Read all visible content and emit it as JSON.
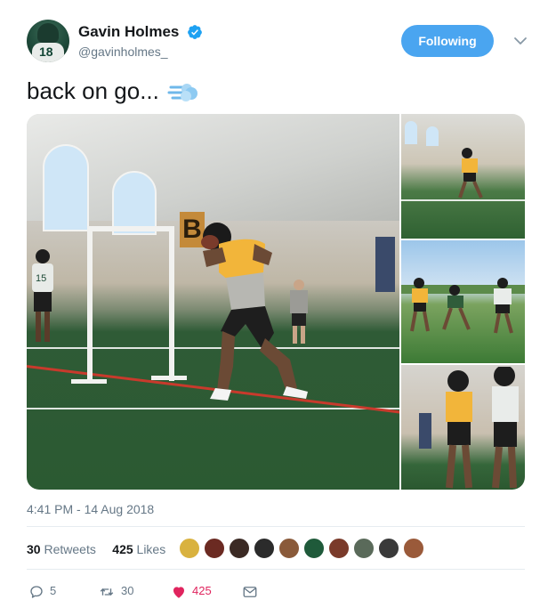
{
  "user": {
    "display_name": "Gavin Holmes",
    "handle": "@gavinholmes_",
    "avatar_jersey_number": "18"
  },
  "follow_button": {
    "label": "Following"
  },
  "tweet": {
    "text": "back on go...",
    "emoji_icon": "dash-emoji"
  },
  "media": {
    "photo_count": 4,
    "main_photo_sign": "B",
    "main_photo_jersey": "15"
  },
  "timestamp": "4:41 PM - 14 Aug 2018",
  "stats": {
    "retweets_count": "30",
    "retweets_label": "Retweets",
    "likes_count": "425",
    "likes_label": "Likes",
    "liker_avatars": 10
  },
  "actions": {
    "reply_count": "5",
    "retweet_count": "30",
    "like_count": "425"
  },
  "colors": {
    "accent": "#1da1f2",
    "follow_button": "#4aa5f0",
    "like": "#e0245e",
    "muted_text": "#657786"
  }
}
